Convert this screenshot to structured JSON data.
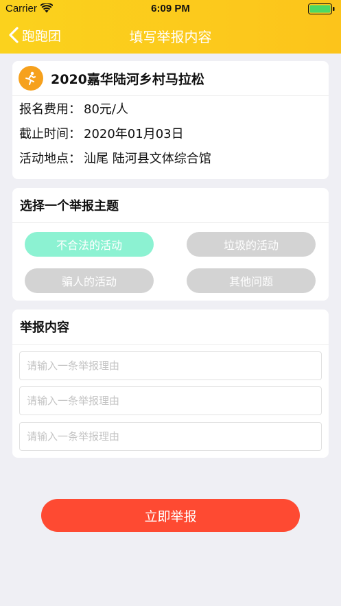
{
  "status_bar": {
    "carrier": "Carrier",
    "time": "6:09 PM"
  },
  "nav": {
    "back_label": "跑跑团",
    "title": "填写举报内容"
  },
  "event": {
    "name": "2020嘉华陆河乡村马拉松",
    "fee_label": "报名费用：",
    "fee_value": "80元/人",
    "deadline_label": "截止时间：",
    "deadline_value": "2020年01月03日",
    "location_label": "活动地点：",
    "location_value": "汕尾 陆河县文体综合馆"
  },
  "topic": {
    "heading": "选择一个举报主题",
    "options": [
      "不合法的活动",
      "垃圾的活动",
      "骗人的活动",
      "其他问题"
    ],
    "selected": "不合法的活动"
  },
  "report": {
    "heading": "举报内容",
    "fields": [
      {
        "value": "",
        "placeholder": "请输入一条举报理由"
      },
      {
        "value": "",
        "placeholder": "请输入一条举报理由"
      },
      {
        "value": "",
        "placeholder": "请输入一条举报理由"
      }
    ]
  },
  "submit": {
    "label": "立即举报"
  },
  "colors": {
    "header": "#fcc41b",
    "selected_pill": "#8cf2d2",
    "pill": "#d3d3d3",
    "submit": "#fe4a32"
  },
  "icons": {
    "back": "chevron-left-icon",
    "event": "runner-icon",
    "network": "wifi-icon",
    "power": "battery-icon"
  }
}
